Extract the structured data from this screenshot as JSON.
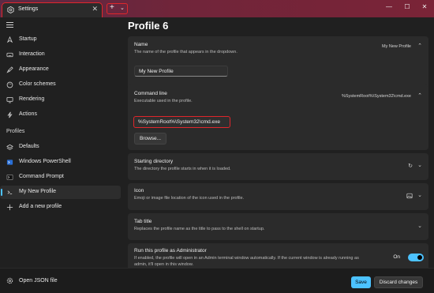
{
  "window": {
    "tab_title": "Settings",
    "newtab_plus": "+",
    "newtab_dropdown": "⌄",
    "close_glyph": "✕",
    "minimize_glyph": "—",
    "maximize_glyph": "☐"
  },
  "sidebar": {
    "items": [
      {
        "label": "Startup",
        "icon": "rocket-icon"
      },
      {
        "label": "Interaction",
        "icon": "keyboard-icon"
      },
      {
        "label": "Appearance",
        "icon": "brush-icon"
      },
      {
        "label": "Color schemes",
        "icon": "palette-icon"
      },
      {
        "label": "Rendering",
        "icon": "monitor-icon"
      },
      {
        "label": "Actions",
        "icon": "lightning-icon"
      }
    ],
    "profiles_header": "Profiles",
    "profiles": [
      {
        "label": "Defaults",
        "icon": "layers-icon"
      },
      {
        "label": "Windows PowerShell",
        "icon": "powershell-icon"
      },
      {
        "label": "Command Prompt",
        "icon": "cmd-icon"
      },
      {
        "label": "My New Profile",
        "icon": "terminal-icon",
        "active": true
      }
    ],
    "add_profile": "Add a new profile"
  },
  "main": {
    "title": "Profile 6",
    "name": {
      "title": "Name",
      "desc": "The name of the profile that appears in the dropdown.",
      "value": "My New Profile",
      "input": "My New Profile"
    },
    "command_line": {
      "title": "Command line",
      "desc": "Executable used in the profile.",
      "value": "%SystemRoot%\\System32\\cmd.exe",
      "input": "%SystemRoot%\\System32\\cmd.exe",
      "browse": "Browse..."
    },
    "starting_directory": {
      "title": "Starting directory",
      "desc": "The directory the profile starts in when it is loaded."
    },
    "icon": {
      "title": "Icon",
      "desc": "Emoji or image file location of the icon used in the profile."
    },
    "tab_title": {
      "title": "Tab title",
      "desc": "Replaces the profile name as the title to pass to the shell on startup."
    },
    "admin": {
      "title": "Run this profile as Administrator",
      "desc_line1": "If enabled, the profile will open in an Admin terminal window automatically. If the current window is already running as",
      "desc_line2": "admin, it'll open in this window.",
      "toggle_label": "On",
      "toggle_on": true
    }
  },
  "footer": {
    "open_json": "Open JSON file",
    "save": "Save",
    "discard": "Discard changes"
  },
  "colors": {
    "accent": "#4cc2ff",
    "highlight": "#e0262b",
    "titlebar": "#70253a"
  }
}
